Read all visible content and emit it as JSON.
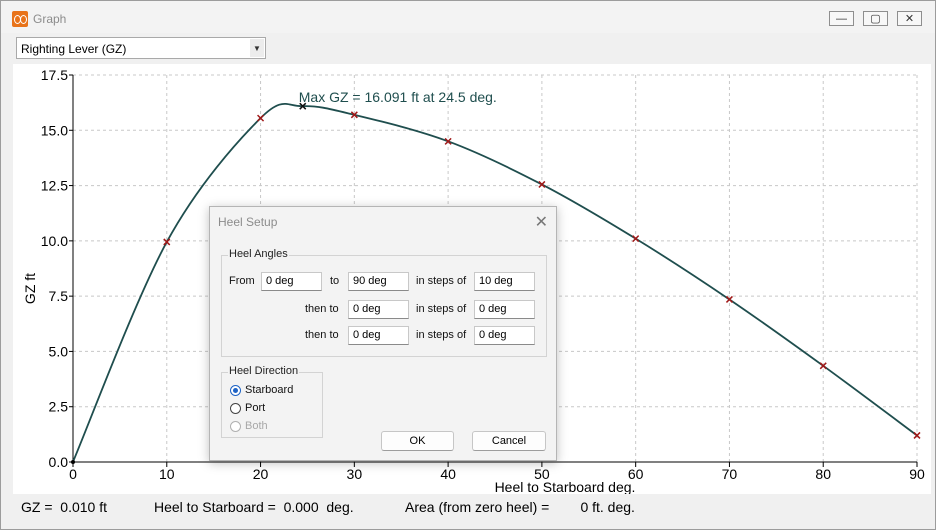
{
  "window": {
    "title": "Graph",
    "controls": {
      "minimize": "—",
      "maximize": "▢",
      "close": "✕"
    }
  },
  "combo": {
    "selected": "Righting Lever (GZ)"
  },
  "chart_data": {
    "type": "line",
    "xlabel": "Heel to Starboard   deg.",
    "ylabel": "GZ  ft",
    "xlim": [
      0,
      90
    ],
    "ylim": [
      0,
      17.5
    ],
    "x_ticks": [
      0,
      10,
      20,
      30,
      40,
      50,
      60,
      70,
      80,
      90
    ],
    "y_ticks": [
      0.0,
      2.5,
      5.0,
      7.5,
      10.0,
      12.5,
      15.0,
      17.5
    ],
    "y_tick_labels": [
      "0.0",
      "2.5",
      "5.0",
      "7.5",
      "10.0",
      "12.5",
      "15.0",
      "17.5"
    ],
    "grid": true,
    "line_color": "#1f4e4e",
    "marker_color": "#a01818",
    "series": [
      {
        "x": [
          0,
          10,
          20,
          24.5,
          30,
          40,
          50,
          60,
          70,
          80,
          90
        ],
        "values": [
          0.01,
          9.95,
          15.55,
          16.09,
          15.7,
          14.5,
          12.55,
          10.1,
          7.35,
          4.35,
          1.2
        ]
      }
    ],
    "markers": [
      {
        "x": 10,
        "y": 9.95
      },
      {
        "x": 20,
        "y": 15.55
      },
      {
        "x": 24.5,
        "y": 16.09
      },
      {
        "x": 30,
        "y": 15.7
      },
      {
        "x": 40,
        "y": 14.5
      },
      {
        "x": 50,
        "y": 12.55
      },
      {
        "x": 60,
        "y": 10.1
      },
      {
        "x": 70,
        "y": 7.35
      },
      {
        "x": 80,
        "y": 4.35
      },
      {
        "x": 90,
        "y": 1.2
      }
    ],
    "annotation": {
      "text": "Max GZ = 16.091 ft at 24.5 deg.",
      "x": 24.5,
      "y": 16.091
    }
  },
  "status": {
    "gz": "GZ =  0.010 ft",
    "heel": "Heel to Starboard =  0.000  deg.",
    "area": "Area (from zero heel) =        0 ft. deg."
  },
  "dialog": {
    "title": "Heel Setup",
    "close": "✕",
    "heel_angles": {
      "label": "Heel Angles",
      "from_label": "From",
      "to_label": "to",
      "then_to_label": "then to",
      "in_steps_of_label": "in steps of",
      "rows": [
        {
          "from": "0 deg",
          "to": "90 deg",
          "step": "10 deg"
        },
        {
          "to": "0 deg",
          "step": "0 deg"
        },
        {
          "to": "0 deg",
          "step": "0 deg"
        }
      ]
    },
    "heel_direction": {
      "label": "Heel Direction",
      "options": [
        "Starboard",
        "Port",
        "Both"
      ],
      "selected": "Starboard"
    },
    "ok_label": "OK",
    "cancel_label": "Cancel"
  }
}
